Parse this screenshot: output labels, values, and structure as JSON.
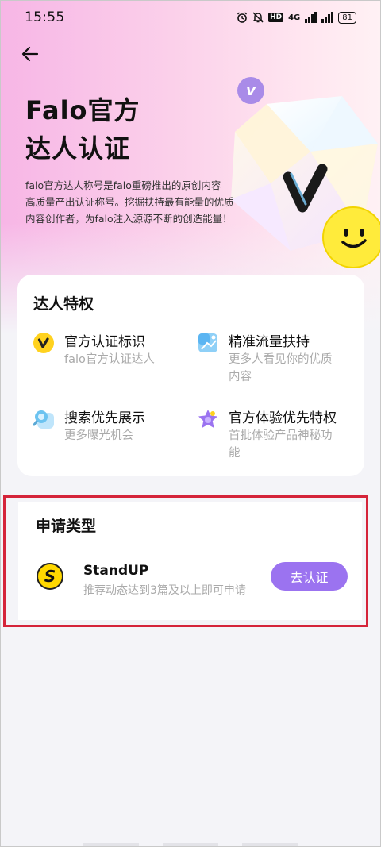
{
  "status_bar": {
    "time": "15:55",
    "hd": "HD",
    "network": "4G",
    "battery": "81"
  },
  "hero": {
    "title_line1": "Falo官方",
    "title_line2": "达人认证",
    "desc_line1": "falo官方达人称号是falo重磅推出的原创内容",
    "desc_line2": "高质量产出认证称号。挖掘扶持最有能量的优质",
    "desc_line3": "内容创作者，为falo注入源源不断的创造能量！",
    "badge_letter": "v"
  },
  "privileges": {
    "title": "达人特权",
    "items": [
      {
        "name": "官方认证标识",
        "sub": [
          "falo官方认证达人"
        ],
        "icon": "v-badge-icon",
        "color": "#ffd21f"
      },
      {
        "name": "精准流量扶持",
        "sub": [
          "更多人看见你的优质",
          "内容"
        ],
        "icon": "image-traffic-icon",
        "color": "#5bb5f2"
      },
      {
        "name": "搜索优先展示",
        "sub": [
          "更多曝光机会"
        ],
        "icon": "search-bubble-icon",
        "color": "#6cc3f0"
      },
      {
        "name": "官方体验优先特权",
        "sub": [
          "首批体验产品神秘功",
          "能"
        ],
        "icon": "star-gift-icon",
        "color": "#9b73f0"
      }
    ]
  },
  "apply": {
    "title": "申请类型",
    "logo_letter": "S",
    "name": "StandUP",
    "desc": "推荐动态达到3篇及以上即可申请",
    "button": "去认证"
  },
  "colors": {
    "accent": "#9b73f0",
    "highlight": "#d5243a"
  }
}
